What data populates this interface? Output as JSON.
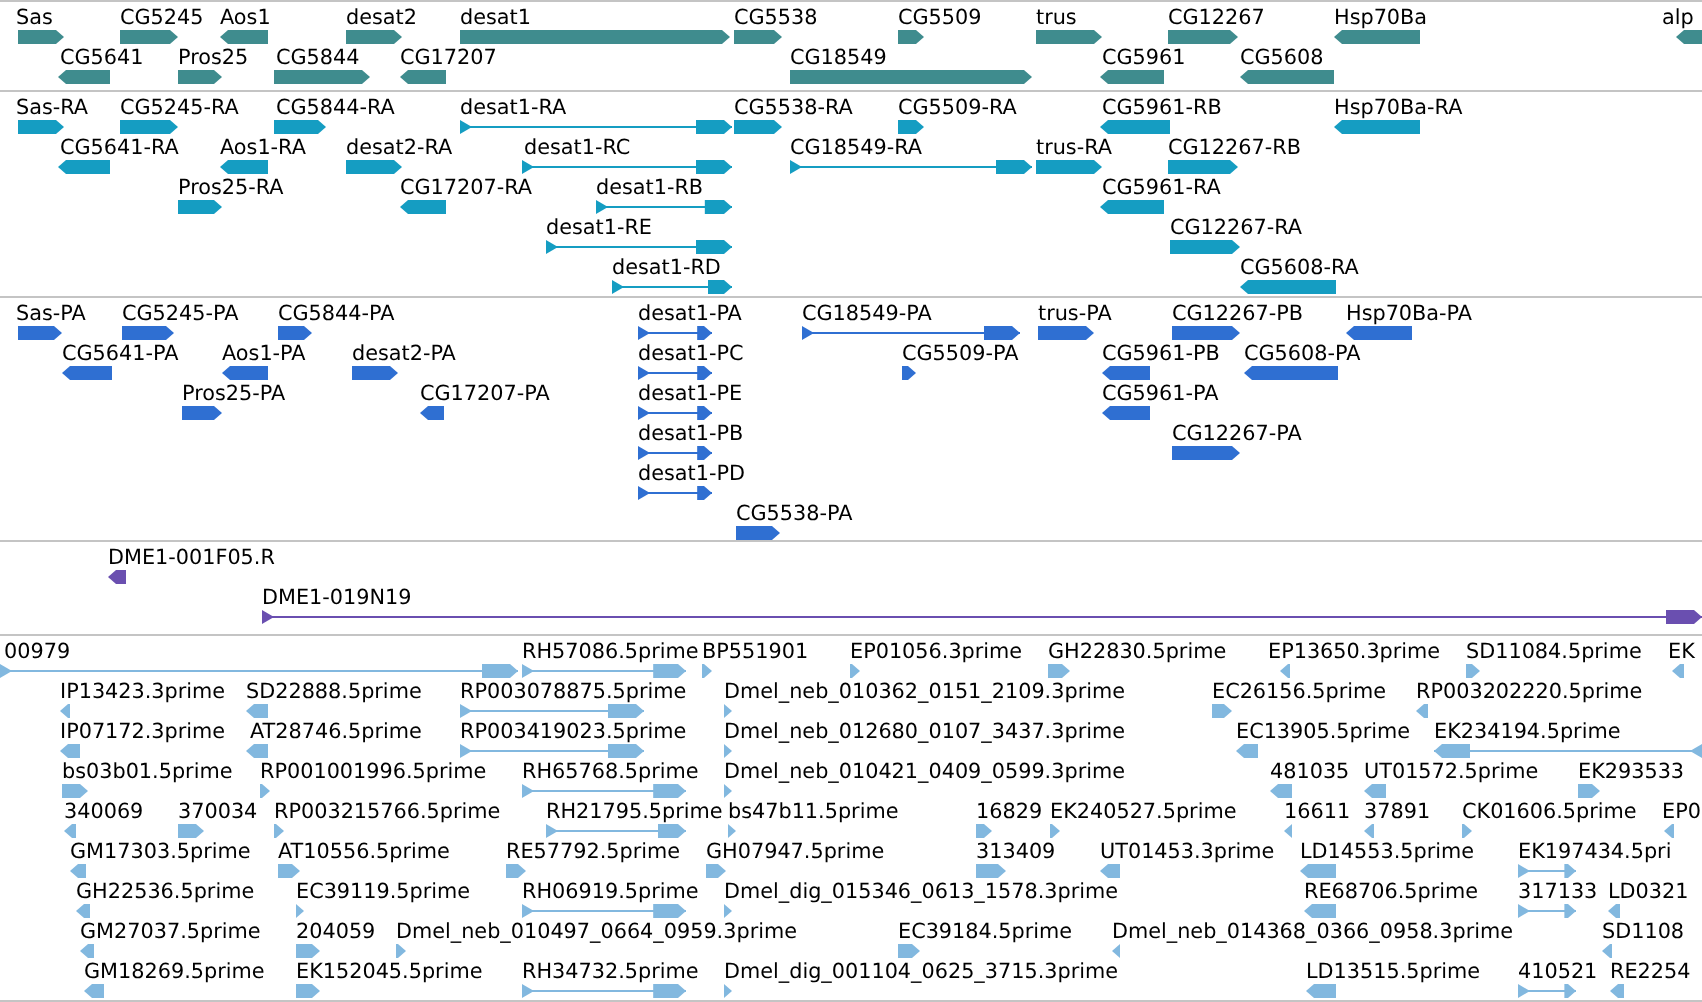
{
  "tracks": [
    {
      "kind": "gene",
      "rows": [
        {
          "features": [
            {
              "label": "Sas",
              "reverse": false
            },
            {
              "label": "CG5245",
              "reverse": false
            },
            {
              "label": "Aos1",
              "reverse": true
            },
            {
              "label": "desat2",
              "reverse": false
            },
            {
              "label": "desat1",
              "reverse": false
            },
            {
              "label": "CG5538",
              "reverse": false
            },
            {
              "label": "CG5509",
              "reverse": false
            },
            {
              "label": "trus",
              "reverse": false
            },
            {
              "label": "CG12267",
              "reverse": false
            },
            {
              "label": "Hsp70Ba",
              "reverse": true
            },
            {
              "label": "alp",
              "reverse": true
            }
          ]
        },
        {
          "features": [
            {
              "label": "CG5641",
              "reverse": true
            },
            {
              "label": "Pros25",
              "reverse": false
            },
            {
              "label": "CG5844",
              "reverse": false
            },
            {
              "label": "CG17207",
              "reverse": true
            },
            {
              "label": "CG18549",
              "reverse": false
            },
            {
              "label": "CG5961",
              "reverse": true
            },
            {
              "label": "CG5608",
              "reverse": true
            }
          ]
        }
      ]
    },
    {
      "kind": "transcript",
      "rows": [
        {
          "features": [
            {
              "label": "Sas-RA",
              "reverse": false
            },
            {
              "label": "CG5245-RA",
              "reverse": false
            },
            {
              "label": "CG5844-RA",
              "reverse": false
            },
            {
              "label": "desat1-RA",
              "reverse": false
            },
            {
              "label": "CG5538-RA",
              "reverse": false
            },
            {
              "label": "CG5509-RA",
              "reverse": false
            },
            {
              "label": "CG5961-RB",
              "reverse": true
            },
            {
              "label": "Hsp70Ba-RA",
              "reverse": true
            }
          ]
        },
        {
          "features": [
            {
              "label": "CG5641-RA",
              "reverse": true
            },
            {
              "label": "Aos1-RA",
              "reverse": true
            },
            {
              "label": "desat2-RA",
              "reverse": false
            },
            {
              "label": "desat1-RC",
              "reverse": false
            },
            {
              "label": "CG18549-RA",
              "reverse": false
            },
            {
              "label": "trus-RA",
              "reverse": false
            },
            {
              "label": "CG12267-RB",
              "reverse": false
            }
          ]
        },
        {
          "features": [
            {
              "label": "Pros25-RA",
              "reverse": false
            },
            {
              "label": "CG17207-RA",
              "reverse": true
            },
            {
              "label": "desat1-RB",
              "reverse": false
            },
            {
              "label": "CG5961-RA",
              "reverse": true
            }
          ]
        },
        {
          "features": [
            {
              "label": "desat1-RE",
              "reverse": false
            },
            {
              "label": "CG12267-RA",
              "reverse": false
            }
          ]
        },
        {
          "features": [
            {
              "label": "desat1-RD",
              "reverse": false
            },
            {
              "label": "CG5608-RA",
              "reverse": true
            }
          ]
        }
      ]
    },
    {
      "kind": "protein",
      "rows": [
        {
          "features": [
            {
              "label": "Sas-PA",
              "reverse": false
            },
            {
              "label": "CG5245-PA",
              "reverse": false
            },
            {
              "label": "CG5844-PA",
              "reverse": false
            },
            {
              "label": "desat1-PA",
              "reverse": false
            },
            {
              "label": "CG18549-PA",
              "reverse": false
            },
            {
              "label": "trus-PA",
              "reverse": false
            },
            {
              "label": "CG12267-PB",
              "reverse": false
            },
            {
              "label": "Hsp70Ba-PA",
              "reverse": true
            }
          ]
        },
        {
          "features": [
            {
              "label": "CG5641-PA",
              "reverse": true
            },
            {
              "label": "Aos1-PA",
              "reverse": true
            },
            {
              "label": "desat2-PA",
              "reverse": false
            },
            {
              "label": "desat1-PC",
              "reverse": false
            },
            {
              "label": "CG5509-PA",
              "reverse": false
            },
            {
              "label": "CG5961-PB",
              "reverse": true
            },
            {
              "label": "CG5608-PA",
              "reverse": true
            }
          ]
        },
        {
          "features": [
            {
              "label": "Pros25-PA",
              "reverse": false
            },
            {
              "label": "CG17207-PA",
              "reverse": true
            },
            {
              "label": "desat1-PE",
              "reverse": false
            },
            {
              "label": "CG5961-PA",
              "reverse": true
            }
          ]
        },
        {
          "features": [
            {
              "label": "desat1-PB",
              "reverse": false
            },
            {
              "label": "CG12267-PA",
              "reverse": false
            }
          ]
        },
        {
          "features": [
            {
              "label": "desat1-PD",
              "reverse": false
            }
          ]
        },
        {
          "features": [
            {
              "label": "CG5538-PA",
              "reverse": false
            }
          ]
        }
      ]
    },
    {
      "kind": "clone",
      "rows": [
        {
          "features": [
            {
              "label": "DME1-001F05.R",
              "reverse": true
            }
          ]
        },
        {
          "features": [
            {
              "label": "DME1-019N19",
              "reverse": false
            }
          ]
        }
      ]
    },
    {
      "kind": "est",
      "rows": [
        {
          "features": [
            {
              "label": "00979",
              "reverse": false
            },
            {
              "label": "RH57086.5prime",
              "reverse": false
            },
            {
              "label": "BP551901",
              "reverse": false
            },
            {
              "label": "EP01056.3prime",
              "reverse": false
            },
            {
              "label": "GH22830.5prime",
              "reverse": false
            },
            {
              "label": "EP13650.3prime",
              "reverse": true
            },
            {
              "label": "SD11084.5prime",
              "reverse": false
            },
            {
              "label": "EK",
              "reverse": true
            }
          ]
        },
        {
          "features": [
            {
              "label": "IP13423.3prime",
              "reverse": true
            },
            {
              "label": "SD22888.5prime",
              "reverse": true
            },
            {
              "label": "RP003078875.5prime",
              "reverse": false
            },
            {
              "label": "Dmel_neb_010362_0151_2109.3prime",
              "reverse": false
            },
            {
              "label": "EC26156.5prime",
              "reverse": false
            },
            {
              "label": "RP003202220.5prime",
              "reverse": true
            }
          ]
        },
        {
          "features": [
            {
              "label": "IP07172.3prime",
              "reverse": true
            },
            {
              "label": "AT28746.5prime",
              "reverse": true
            },
            {
              "label": "RP003419023.5prime",
              "reverse": false
            },
            {
              "label": "Dmel_neb_012680_0107_3437.3prime",
              "reverse": false
            },
            {
              "label": "EC13905.5prime",
              "reverse": true
            },
            {
              "label": "EK234194.5prime",
              "reverse": true
            }
          ]
        },
        {
          "features": [
            {
              "label": "bs03b01.5prime",
              "reverse": false
            },
            {
              "label": "RP001001996.5prime",
              "reverse": false
            },
            {
              "label": "RH65768.5prime",
              "reverse": false
            },
            {
              "label": "Dmel_neb_010421_0409_0599.3prime",
              "reverse": false
            },
            {
              "label": "481035",
              "reverse": true
            },
            {
              "label": "UT01572.5prime",
              "reverse": true
            },
            {
              "label": "EK293533",
              "reverse": false
            }
          ]
        },
        {
          "features": [
            {
              "label": "340069",
              "reverse": true
            },
            {
              "label": "370034",
              "reverse": false
            },
            {
              "label": "RP003215766.5prime",
              "reverse": false
            },
            {
              "label": "RH21795.5prime",
              "reverse": false
            },
            {
              "label": "bs47b11.5prime",
              "reverse": false
            },
            {
              "label": "16829",
              "reverse": false
            },
            {
              "label": "EK240527.5prime",
              "reverse": false
            },
            {
              "label": "16611",
              "reverse": true
            },
            {
              "label": "37891",
              "reverse": true
            },
            {
              "label": "CK01606.5prime",
              "reverse": false
            },
            {
              "label": "EP0",
              "reverse": true
            }
          ]
        },
        {
          "features": [
            {
              "label": "GM17303.5prime",
              "reverse": true
            },
            {
              "label": "AT10556.5prime",
              "reverse": false
            },
            {
              "label": "RE57792.5prime",
              "reverse": false
            },
            {
              "label": "GH07947.5prime",
              "reverse": false
            },
            {
              "label": "313409",
              "reverse": false
            },
            {
              "label": "UT01453.3prime",
              "reverse": true
            },
            {
              "label": "LD14553.5prime",
              "reverse": true
            },
            {
              "label": "EK197434.5pri",
              "reverse": false
            }
          ]
        },
        {
          "features": [
            {
              "label": "GH22536.5prime",
              "reverse": true
            },
            {
              "label": "EC39119.5prime",
              "reverse": false
            },
            {
              "label": "RH06919.5prime",
              "reverse": false
            },
            {
              "label": "Dmel_dig_015346_0613_1578.3prime",
              "reverse": false
            },
            {
              "label": "RE68706.5prime",
              "reverse": true
            },
            {
              "label": "317133",
              "reverse": false
            },
            {
              "label": "LD0321",
              "reverse": true
            }
          ]
        },
        {
          "features": [
            {
              "label": "GM27037.5prime",
              "reverse": true
            },
            {
              "label": "204059",
              "reverse": false
            },
            {
              "label": "Dmel_neb_010497_0664_0959.3prime",
              "reverse": false
            },
            {
              "label": "EC39184.5prime",
              "reverse": false
            },
            {
              "label": "Dmel_neb_014368_0366_0958.3prime",
              "reverse": true
            },
            {
              "label": "SD1108",
              "reverse": true
            }
          ]
        },
        {
          "features": [
            {
              "label": "GM18269.5prime",
              "reverse": true
            },
            {
              "label": "EK152045.5prime",
              "reverse": false
            },
            {
              "label": "RH34732.5prime",
              "reverse": false
            },
            {
              "label": "Dmel_dig_001104_0625_3715.3prime",
              "reverse": false
            },
            {
              "label": "LD13515.5prime",
              "reverse": true
            },
            {
              "label": "410521",
              "reverse": false
            },
            {
              "label": "RE2254",
              "reverse": true
            }
          ]
        }
      ]
    }
  ]
}
